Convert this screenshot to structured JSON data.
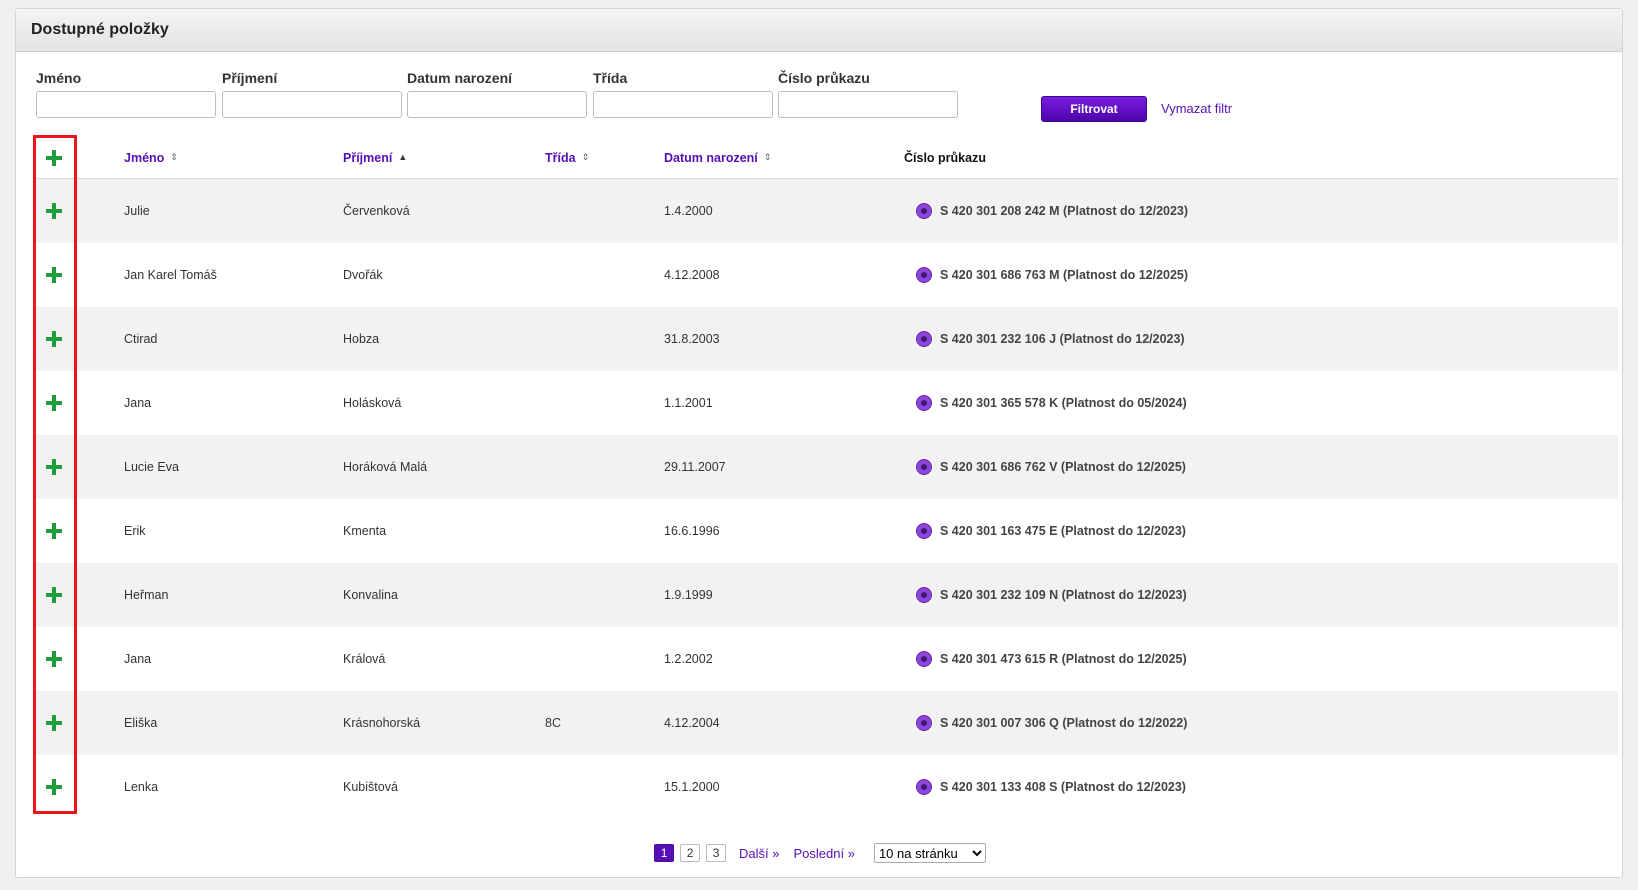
{
  "panel": {
    "title": "Dostupné položky"
  },
  "filter": {
    "fields": [
      {
        "label": "Jméno",
        "value": ""
      },
      {
        "label": "Příjmení",
        "value": ""
      },
      {
        "label": "Datum narození",
        "value": ""
      },
      {
        "label": "Třída",
        "value": ""
      },
      {
        "label": "Číslo průkazu",
        "value": ""
      }
    ],
    "submit_label": "Filtrovat",
    "clear_label": "Vymazat filtr"
  },
  "table": {
    "headers": {
      "first_name": "Jméno",
      "last_name": "Příjmení",
      "class": "Třída",
      "birth_date": "Datum narození",
      "card_number": "Číslo průkazu"
    },
    "sort": {
      "column": "last_name",
      "direction": "asc"
    },
    "rows": [
      {
        "first_name": "Julie",
        "last_name": "Červenková",
        "class": "",
        "birth_date": "1.4.2000",
        "card": "S 420 301 208 242 M (Platnost do 12/2023)"
      },
      {
        "first_name": "Jan Karel Tomáš",
        "last_name": "Dvořák",
        "class": "",
        "birth_date": "4.12.2008",
        "card": "S 420 301 686 763 M (Platnost do 12/2025)"
      },
      {
        "first_name": "Ctirad",
        "last_name": "Hobza",
        "class": "",
        "birth_date": "31.8.2003",
        "card": "S 420 301 232 106 J (Platnost do 12/2023)"
      },
      {
        "first_name": "Jana",
        "last_name": "Holásková",
        "class": "",
        "birth_date": "1.1.2001",
        "card": "S 420 301 365 578 K (Platnost do 05/2024)"
      },
      {
        "first_name": "Lucie Eva",
        "last_name": "Horáková Malá",
        "class": "",
        "birth_date": "29.11.2007",
        "card": "S 420 301 686 762 V (Platnost do 12/2025)"
      },
      {
        "first_name": "Erik",
        "last_name": "Kmenta",
        "class": "",
        "birth_date": "16.6.1996",
        "card": "S 420 301 163 475 E (Platnost do 12/2023)"
      },
      {
        "first_name": "Heřman",
        "last_name": "Konvalina",
        "class": "",
        "birth_date": "1.9.1999",
        "card": "S 420 301 232 109 N (Platnost do 12/2023)"
      },
      {
        "first_name": "Jana",
        "last_name": "Králová",
        "class": "",
        "birth_date": "1.2.2002",
        "card": "S 420 301 473 615 R (Platnost do 12/2025)"
      },
      {
        "first_name": "Eliška",
        "last_name": "Krásnohorská",
        "class": "8C",
        "birth_date": "4.12.2004",
        "card": "S 420 301 007 306 Q (Platnost do 12/2022)"
      },
      {
        "first_name": "Lenka",
        "last_name": "Kubištová",
        "class": "",
        "birth_date": "15.1.2000",
        "card": "S 420 301 133 408 S (Platnost do 12/2023)"
      }
    ]
  },
  "pagination": {
    "pages": [
      "1",
      "2",
      "3"
    ],
    "current": "1",
    "next_label": "Další »",
    "last_label": "Poslední »",
    "per_page_options": [
      "10 na stránku"
    ],
    "per_page_selected": "10 na stránku"
  },
  "colors": {
    "accent": "#5510b5",
    "add_icon": "#1e9e3a",
    "highlight_box": "#e8151b"
  },
  "icons": {
    "add": "plus-icon",
    "card": "card-status-icon",
    "sort_neutral": "sort-both-icon",
    "sort_asc": "sort-asc-icon"
  }
}
